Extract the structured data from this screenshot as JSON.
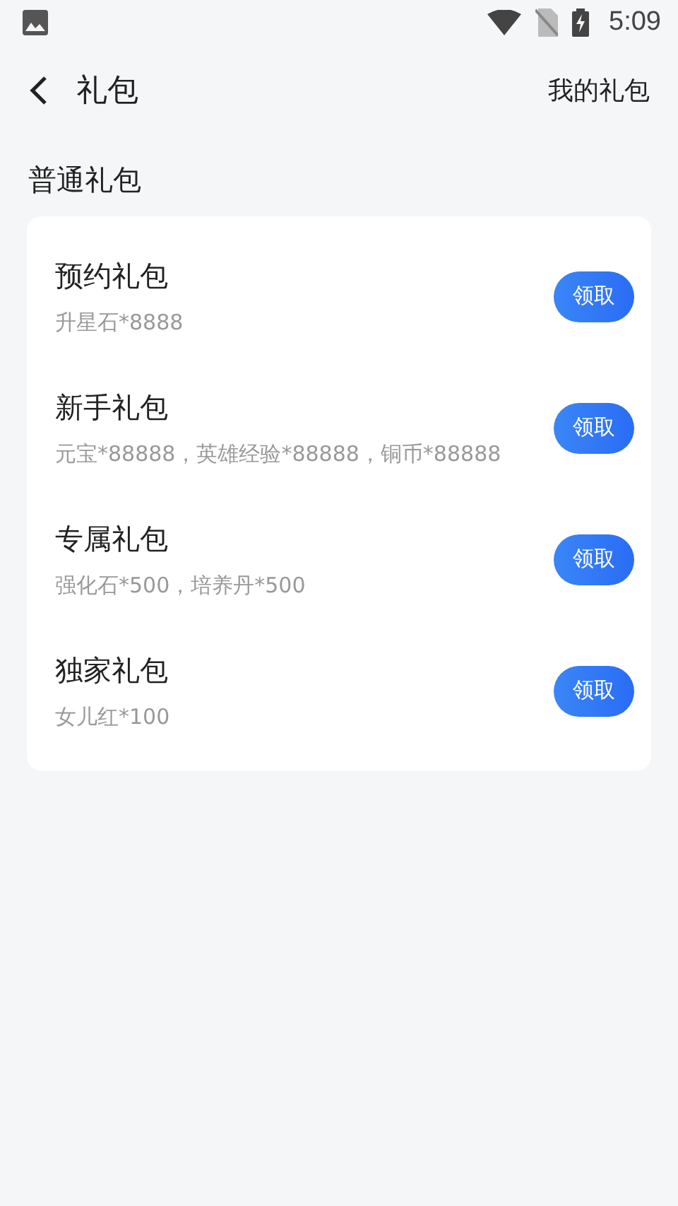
{
  "status_bar": {
    "time": "5:09"
  },
  "header": {
    "title": "礼包",
    "action": "我的礼包"
  },
  "section": {
    "title": "普通礼包"
  },
  "gifts": [
    {
      "name": "预约礼包",
      "contents": "升星石*8888",
      "button": "领取"
    },
    {
      "name": "新手礼包",
      "contents": "元宝*88888，英雄经验*88888，铜币*88888",
      "button": "领取"
    },
    {
      "name": "专属礼包",
      "contents": "强化石*500，培养丹*500",
      "button": "领取"
    },
    {
      "name": "独家礼包",
      "contents": "女儿红*100",
      "button": "领取"
    }
  ]
}
